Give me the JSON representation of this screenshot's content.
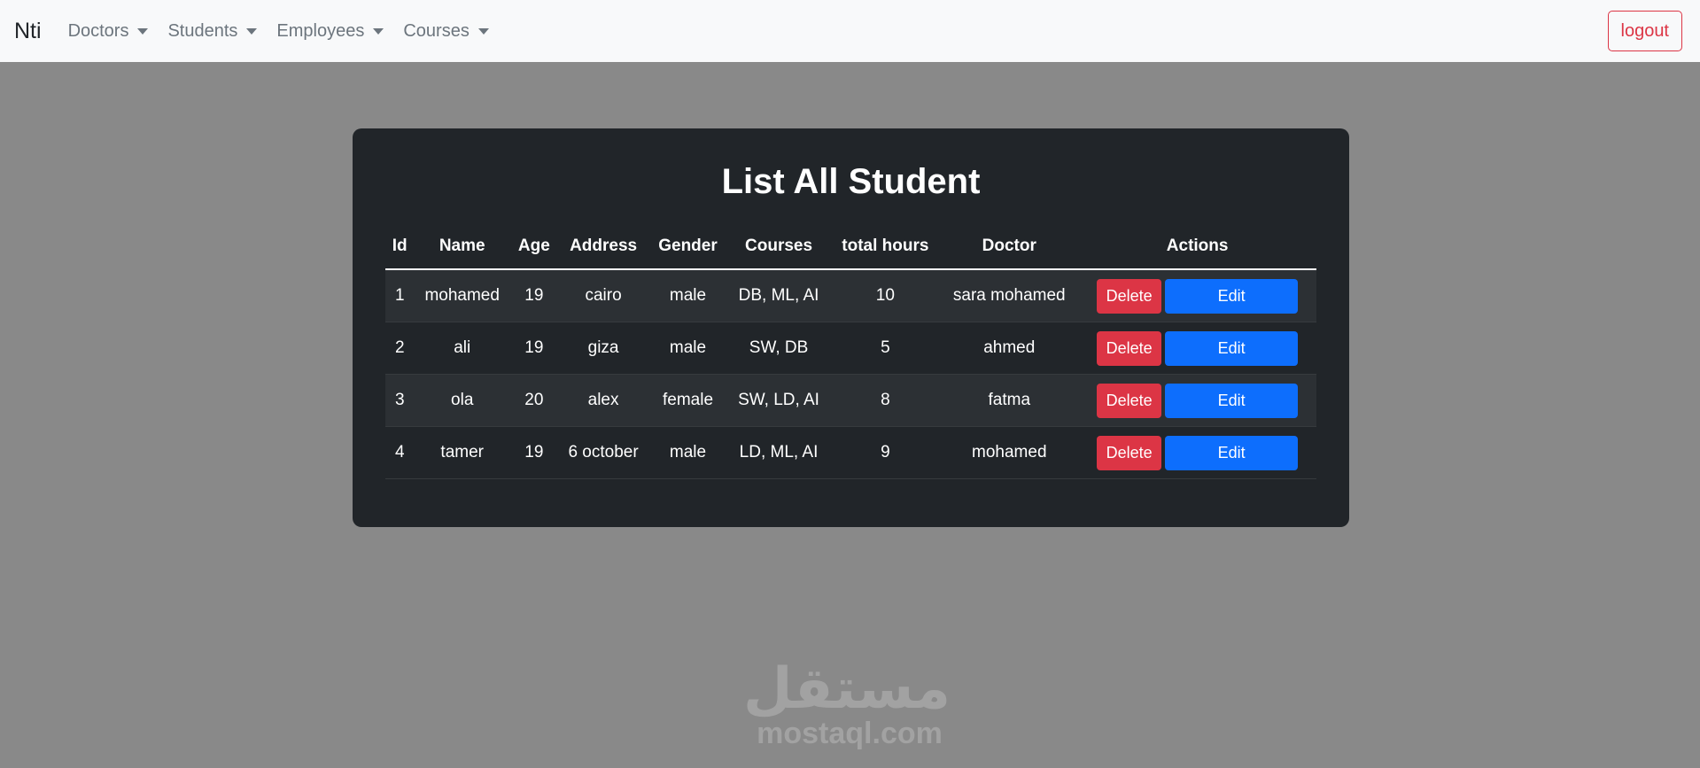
{
  "navbar": {
    "brand": "Nti",
    "menus": [
      {
        "label": "Doctors"
      },
      {
        "label": "Students"
      },
      {
        "label": "Employees"
      },
      {
        "label": "Courses"
      }
    ],
    "logout_label": "logout"
  },
  "main": {
    "title": "List All Student",
    "table": {
      "headers": [
        "Id",
        "Name",
        "Age",
        "Address",
        "Gender",
        "Courses",
        "total hours",
        "Doctor",
        "Actions"
      ],
      "rows": [
        {
          "id": "1",
          "name": "mohamed",
          "age": "19",
          "address": "cairo",
          "gender": "male",
          "courses": "DB, ML, AI",
          "total_hours": "10",
          "doctor": "sara mohamed"
        },
        {
          "id": "2",
          "name": "ali",
          "age": "19",
          "address": "giza",
          "gender": "male",
          "courses": "SW, DB",
          "total_hours": "5",
          "doctor": "ahmed"
        },
        {
          "id": "3",
          "name": "ola",
          "age": "20",
          "address": "alex",
          "gender": "female",
          "courses": "SW, LD, AI",
          "total_hours": "8",
          "doctor": "fatma"
        },
        {
          "id": "4",
          "name": "tamer",
          "age": "19",
          "address": "6 october",
          "gender": "male",
          "courses": "LD, ML, AI",
          "total_hours": "9",
          "doctor": "mohamed"
        }
      ],
      "delete_label": "Delete",
      "edit_label": "Edit"
    }
  },
  "watermark": {
    "arabic": "مستقل",
    "latin": "mostaql.com"
  },
  "colors": {
    "backdrop": "#898989",
    "navbar_bg": "#f8f9fa",
    "card_bg": "#212529",
    "danger": "#dc3545",
    "primary": "#0d6efd"
  }
}
